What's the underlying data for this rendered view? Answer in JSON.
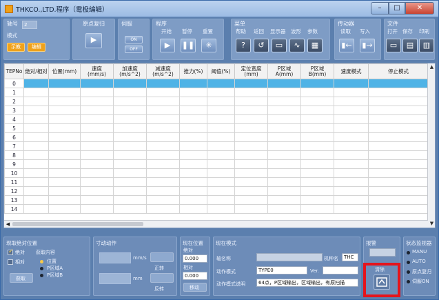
{
  "window": {
    "title": "THKCO.,LTD.程序（電极编辑）",
    "controls": {
      "minimize": "–",
      "maximize": "□",
      "close": "✕"
    }
  },
  "toolbar": {
    "axis": {
      "label": "轴号",
      "value": "2"
    },
    "mode": {
      "label": "模式",
      "btn1": "示教",
      "btn2": "编辑"
    },
    "origin": {
      "label": "原点复归",
      "btn": "▶"
    },
    "servo": {
      "label": "伺服",
      "on": "ON",
      "off": "OFF"
    },
    "program": {
      "label": "程序",
      "start": "开始",
      "pause": "暂停",
      "reset": "重置"
    },
    "menu": {
      "label": "菜单",
      "items": [
        "帮助",
        "返回",
        "显示器",
        "波形",
        "参数"
      ]
    },
    "transfer": {
      "label": "传动器",
      "items": [
        "读取",
        "写入"
      ]
    },
    "file": {
      "label": "文件",
      "items": [
        "打开",
        "保存",
        "印刷"
      ]
    }
  },
  "table": {
    "headers": [
      "TEPNo",
      "绝对/相对",
      "位置(mm)",
      "速度\n(mm/s)",
      "加速度\n(m/s^2)",
      "减速度\n(m/s^2)",
      "推力(%)",
      "阈值(%)",
      "定位宽度\n(mm)",
      "P区域\nA(mm)",
      "P区域\nB(mm)",
      "速度模式",
      "停止模式"
    ],
    "rows": [
      "0",
      "1",
      "2",
      "3",
      "4",
      "5",
      "6",
      "7",
      "8",
      "9",
      "10",
      "11",
      "12",
      "13",
      "14"
    ]
  },
  "bottom": {
    "pos_setting": {
      "title": "现取绝对位置",
      "abs": "绝对",
      "rel": "相对",
      "content": "获取内容",
      "pos": "位置",
      "pzone_a": "P区域A",
      "pzone_b": "P区域B",
      "execute": "获取"
    },
    "jog": {
      "title": "寸动动作",
      "unit_speed": "mm/s",
      "forward": "正转",
      "unit_pos": "mm",
      "reverse": "反转"
    },
    "current": {
      "title": "现在位置",
      "pos_label": "绝对",
      "pos_value": "0.000",
      "speed_label": "相对",
      "speed_value": "0.000",
      "move_btn": "移动"
    },
    "present_mode": {
      "title": "现在模式",
      "axis_name_label": "轴名称",
      "axis_name_value": "",
      "model_label": "机种名",
      "model_value": "THC",
      "action_mode_label": "动作模式",
      "action_mode_value": "TYPE0",
      "ver_label": "Ver.",
      "ver_value": "",
      "desc_label": "动作模式说明",
      "desc_value": "64点，P区域输出，区域输出，有原扫描"
    },
    "alarm": {
      "title": "报警",
      "clear_label": "清除"
    },
    "status": {
      "title": "状态监视器",
      "items": [
        "MANU",
        "AUTO",
        "原点复归",
        "伺服ON"
      ]
    }
  }
}
